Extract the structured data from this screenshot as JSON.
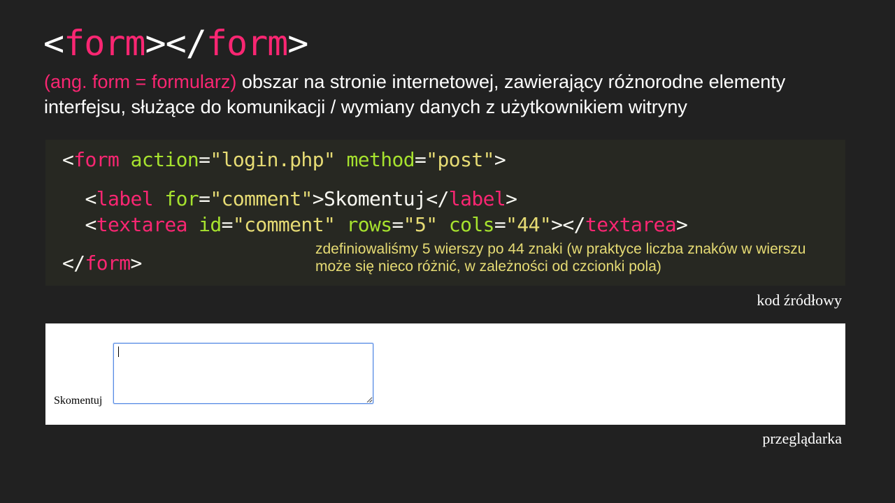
{
  "title": {
    "open_lt": "<",
    "open_tag": "form",
    "open_gt": ">",
    "close_lt": "</",
    "close_tag": "form",
    "close_gt": ">"
  },
  "description": {
    "accent": "(ang. form = formularz)",
    "text": " obszar na stronie internetowej, zawierający różnorodne elementy interfejsu, służące do komunikacji / wymiany danych z użytkownikiem witryny"
  },
  "code": {
    "line1": {
      "lt": "<",
      "tag": "form",
      "attr1": "action",
      "eq1": "=",
      "val1": "\"login.php\"",
      "attr2": "method",
      "eq2": "=",
      "val2": "\"post\"",
      "gt": ">"
    },
    "line2": {
      "lt": "<",
      "tag": "label",
      "attr1": "for",
      "eq1": "=",
      "val1": "\"comment\"",
      "gt": ">",
      "content": "Skomentuj",
      "close_lt": "</",
      "close_tag": "label",
      "close_gt": ">"
    },
    "line3": {
      "lt": "<",
      "tag": "textarea",
      "attr1": "id",
      "eq1": "=",
      "val1": "\"comment\"",
      "attr2": "rows",
      "eq2": "=",
      "val2": "\"5\"",
      "attr3": "cols",
      "eq3": "=",
      "val3": "\"44\"",
      "gt": ">",
      "close_lt": "</",
      "close_tag": "textarea",
      "close_gt": ">"
    },
    "line4": {
      "close_lt": "</",
      "close_tag": "form",
      "close_gt": ">"
    },
    "comment": "zdefiniowaliśmy 5 wierszy po 44 znaki (w praktyce liczba znaków w wierszu może się nieco różnić, w zależności od czcionki pola)"
  },
  "captions": {
    "source": "kod źródłowy",
    "browser": "przeglądarka"
  },
  "preview": {
    "label": "Skomentuj",
    "textarea_value": ""
  },
  "colors": {
    "background": "#212121",
    "code_background": "#272822",
    "tag": "#f92672",
    "attribute": "#a6e22e",
    "string": "#e6db74",
    "focus_border": "#5b8ee6"
  }
}
